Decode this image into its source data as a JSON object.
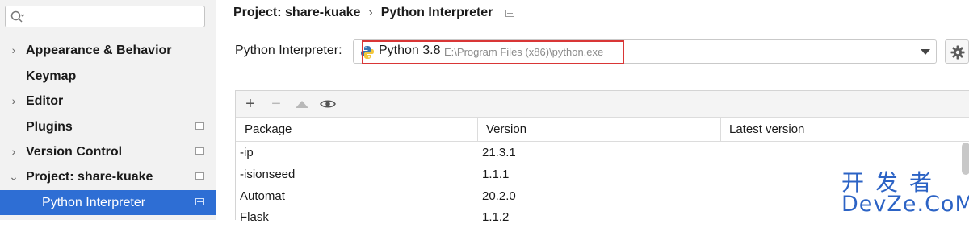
{
  "sidebar": {
    "search": {
      "value": "",
      "placeholder": ""
    },
    "items": [
      {
        "label": "Appearance & Behavior",
        "arrow": "›",
        "pinned": false
      },
      {
        "label": "Keymap",
        "arrow": "",
        "pinned": false
      },
      {
        "label": "Editor",
        "arrow": "›",
        "pinned": false
      },
      {
        "label": "Plugins",
        "arrow": "",
        "pinned": true
      },
      {
        "label": "Version Control",
        "arrow": "›",
        "pinned": true
      },
      {
        "label": "Project: share-kuake",
        "arrow": "⌄",
        "pinned": true
      },
      {
        "label": "Python Interpreter",
        "arrow": "",
        "pinned": true,
        "selected": true
      }
    ]
  },
  "breadcrumb": {
    "project": "Project: share-kuake",
    "separator": "›",
    "page": "Python Interpreter"
  },
  "interpreter": {
    "label": "Python Interpreter:",
    "name": "Python 3.8",
    "path": "E:\\Program Files (x86)\\python.exe",
    "highlight_color": "#d93636"
  },
  "packages": {
    "toolbar": {
      "add": "+",
      "remove": "−"
    },
    "columns": [
      "Package",
      "Version",
      "Latest version"
    ],
    "rows": [
      {
        "package": "-ip",
        "version": "21.3.1",
        "latest": ""
      },
      {
        "package": "-isionseed",
        "version": "1.1.1",
        "latest": ""
      },
      {
        "package": "Automat",
        "version": "20.2.0",
        "latest": ""
      },
      {
        "package": "Flask",
        "version": "1.1.2",
        "latest": ""
      }
    ]
  },
  "watermark": {
    "cn": "开发者",
    "en": "DevZe.CoM"
  },
  "colors": {
    "selection": "#2e6ed4",
    "watermark": "#2c63c5",
    "sidebar_bg": "#f2f2f2"
  }
}
